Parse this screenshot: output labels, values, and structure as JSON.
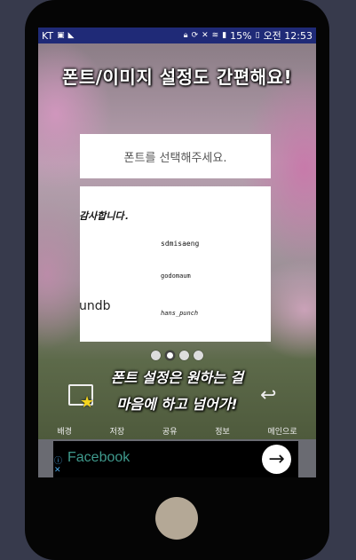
{
  "statusbar": {
    "carrier": "KT",
    "battery": "15%",
    "time": "오전 12:53"
  },
  "headline": "폰트/이미지 설정도 간편해요!",
  "picker": {
    "title": "폰트를 선택해주세요.",
    "samples": {
      "left_top": "감사합니다.",
      "left_bottom": "undb",
      "f1": "sdmisaeng",
      "f2": "godomaum",
      "f3": "hans_punch"
    }
  },
  "pager": {
    "count": 4,
    "active_index": 1
  },
  "caption": {
    "line1": "폰트 설정은 원하는 걸",
    "line2": "마음에 하고 넘어가!"
  },
  "toolbar": {
    "items": [
      "배경",
      "저장",
      "공유",
      "정보",
      "메인으로"
    ]
  },
  "ad": {
    "text": "Facebook",
    "info_icon": "info-icon",
    "close_icon": "close-icon",
    "arrow_icon": "arrow-right-icon"
  },
  "colors": {
    "statusbar": "#1f2a77",
    "page_bg": "#373a4c",
    "ad_text": "#3f9a8d"
  }
}
